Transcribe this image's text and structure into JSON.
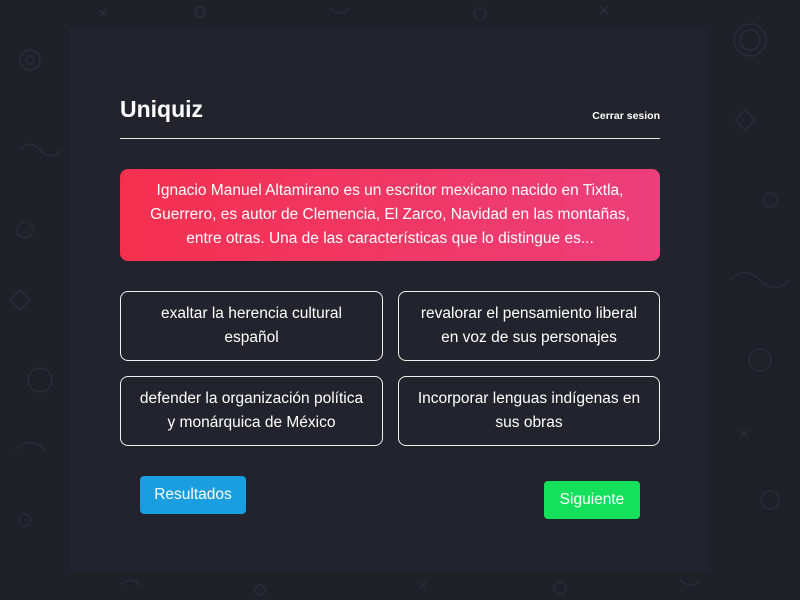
{
  "app": {
    "title": "Uniquiz",
    "logout_label": "Cerrar sesion"
  },
  "question": {
    "text": "Ignacio Manuel Altamirano es un escritor mexicano nacido en Tixtla, Guerrero, es autor de Clemencia, El Zarco, Navidad en las montañas, entre otras. Una de las características que lo distingue es..."
  },
  "options": [
    {
      "label": "exaltar la herencia cultural español"
    },
    {
      "label": "revalorar el pensamiento liberal en voz de sus personajes"
    },
    {
      "label": "defender la organización política y monárquica de México"
    },
    {
      "label": "Incorporar lenguas indígenas en sus obras"
    }
  ],
  "actions": {
    "results_label": "Resultados",
    "next_label": "Siguiente"
  },
  "colors": {
    "background": "#202028",
    "card": "#23232d",
    "question_gradient_start": "#f5304f",
    "question_gradient_end": "#ec3f7b",
    "results_button": "#1a9ee0",
    "next_button": "#14e05c"
  }
}
